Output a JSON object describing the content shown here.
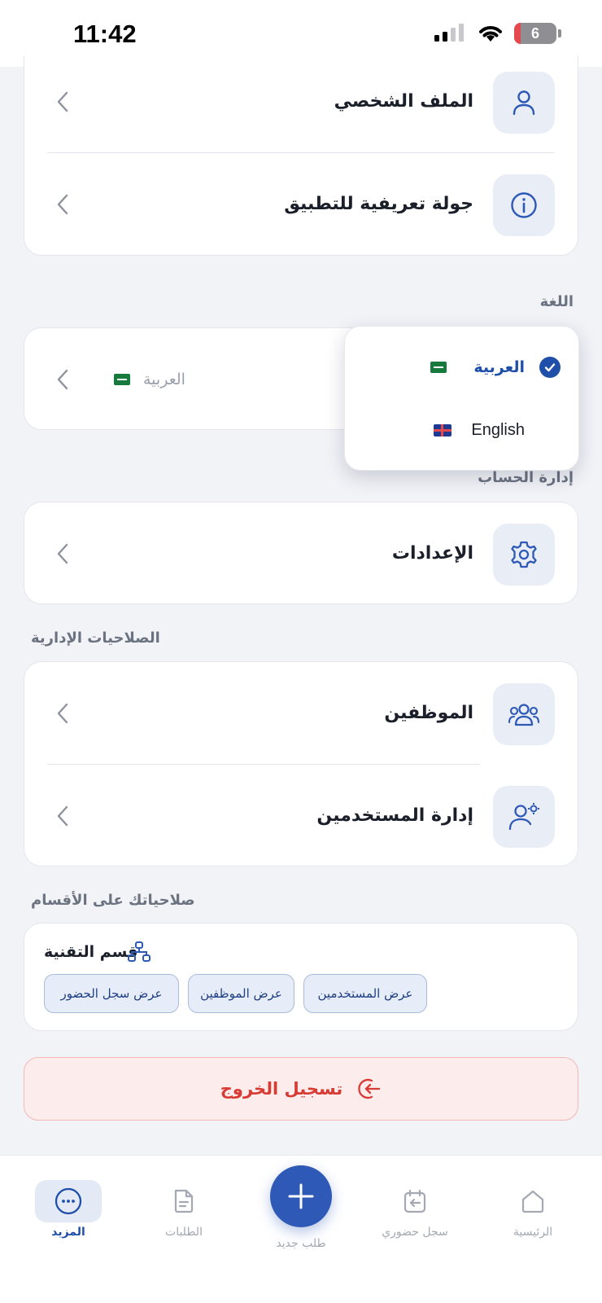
{
  "status_bar": {
    "time": "11:42",
    "battery": "6"
  },
  "account": {
    "items": [
      {
        "label": "الملف الشخصي",
        "icon": "user-icon"
      },
      {
        "label": "جولة تعريفية للتطبيق",
        "icon": "info-icon"
      }
    ]
  },
  "language": {
    "section_title": "اللغة",
    "current_value": "العربية",
    "options": [
      {
        "label": "العربية",
        "flag": "saudi-flag-icon",
        "selected": true
      },
      {
        "label": "English",
        "flag": "uk-flag-icon",
        "selected": false
      }
    ]
  },
  "account_management": {
    "section_title": "إدارة الحساب",
    "items": [
      {
        "label": "الإعدادات",
        "icon": "gear-icon"
      }
    ]
  },
  "admin_permissions": {
    "section_title": "الصلاحيات الإدارية",
    "items": [
      {
        "label": "الموظفين",
        "icon": "users-icon"
      },
      {
        "label": "إدارة المستخدمين",
        "icon": "user-settings-icon"
      }
    ]
  },
  "department_permissions": {
    "section_title": "صلاحياتك على الأقسام",
    "department": "قسم التقنية",
    "chips": [
      "عرض المستخدمين",
      "عرض الموظفين",
      "عرض سجل الحضور"
    ]
  },
  "logout": {
    "label": "تسجيل الخروج"
  },
  "tabbar": {
    "home": "الرئيسية",
    "attendance": "سجل حضوري",
    "new_request": "طلب جديد",
    "requests": "الطلبات",
    "more": "المزيد",
    "active": "more"
  },
  "colors": {
    "primary": "#2e59b7",
    "accent_text": "#1f4fa8",
    "danger": "#d83b34",
    "background": "#f1f3f7"
  }
}
